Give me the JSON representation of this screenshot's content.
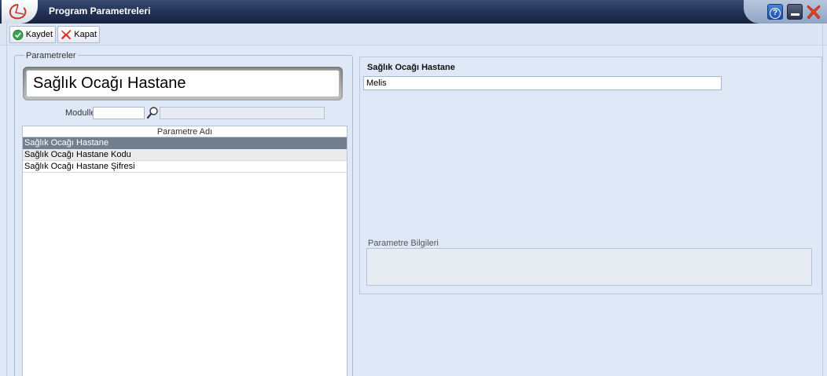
{
  "window": {
    "title": "Program Parametreleri",
    "help_label": "?",
    "colors": {
      "titlebar": "#26355a",
      "background": "#dfe8f6",
      "selected_row": "#727f8e"
    }
  },
  "toolbar": {
    "save_label": "Kaydet",
    "close_label": "Kapat"
  },
  "parametreler": {
    "legend": "Parametreler",
    "search_value": "Sağlık Ocağı Hastane",
    "moduller_label": "Moduller",
    "moduller_value": "",
    "grid": {
      "column_header": "Parametre Adı",
      "rows": [
        "Sağlık Ocağı Hastane",
        "Sağlık Ocağı Hastane Kodu",
        "Sağlık Ocağı Hastane Şifresi"
      ],
      "selected_index": 0
    }
  },
  "detail": {
    "title": "Sağlık Ocağı Hastane",
    "value": "Melis",
    "info_label": "Parametre Bilgileri",
    "info_value": ""
  }
}
